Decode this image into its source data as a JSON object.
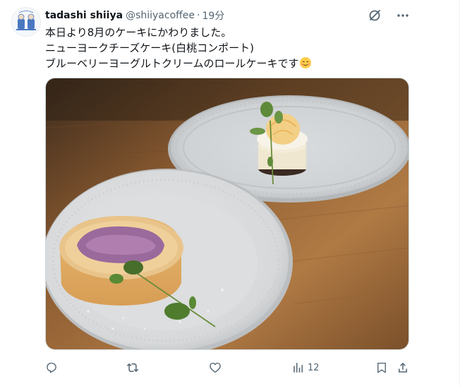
{
  "tweet": {
    "display_name": "tadashi shiiya",
    "handle": "@shiiyacoffee",
    "separator": "·",
    "time": "19分",
    "lines": [
      "本日より8月のケーキにかわりました。",
      "ニューヨークチーズケーキ(白桃コンポート)",
      "ブルーベリーヨーグルトクリームのロールケーキです"
    ],
    "emoji": "smiling-face-emoji"
  },
  "actions": {
    "views_count": "12"
  },
  "colors": {
    "icon_gray": "#536471",
    "text": "#0f1419",
    "grok_icon": "#536471"
  }
}
